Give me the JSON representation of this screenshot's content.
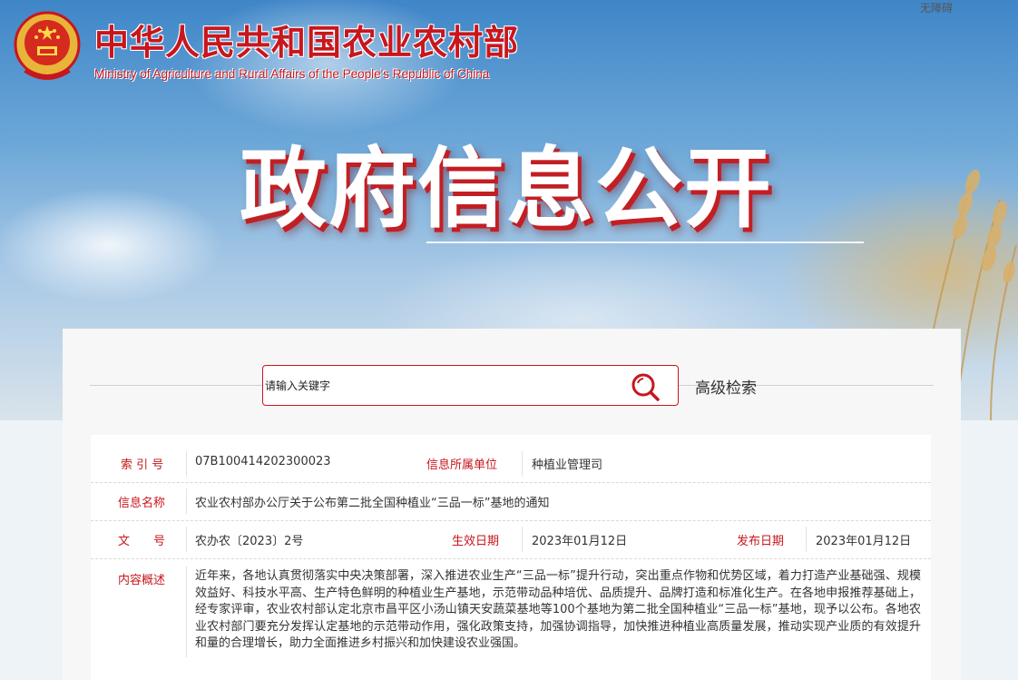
{
  "header": {
    "logo_cn": "中华人民共和国农业农村部",
    "logo_en": "Ministry of Agriculture and Rural Affairs of the People's Republic of China",
    "accessibility": "无障碍",
    "hero_title": "政府信息公开"
  },
  "search": {
    "placeholder": "请输入关键字",
    "advanced": "高级检索"
  },
  "info": {
    "index_label": "索 引 号",
    "index_value": "07B100414202300023",
    "unit_label": "信息所属单位",
    "unit_value": "种植业管理司",
    "name_label": "信息名称",
    "name_value": "农业农村部办公厅关于公布第二批全国种植业“三品一标”基地的通知",
    "doc_label": "文　　号",
    "doc_value": "农办农〔2023〕2号",
    "effective_label": "生效日期",
    "effective_value": "2023年01月12日",
    "publish_label": "发布日期",
    "publish_value": "2023年01月12日",
    "summary_label": "内容概述",
    "summary_value": "近年来，各地认真贯彻落实中央决策部署，深入推进农业生产“三品一标”提升行动，突出重点作物和优势区域，着力打造产业基础强、规模效益好、科技水平高、生产特色鲜明的种植业生产基地，示范带动品种培优、品质提升、品牌打造和标准化生产。在各地申报推荐基础上，经专家评审，农业农村部认定北京市昌平区小汤山镇天安蔬菜基地等100个基地为第二批全国种植业“三品一标”基地，现予以公布。各地农业农村部门要充分发挥认定基地的示范带动作用，强化政策支持，加强协调指导，加快推进种植业高质量发展，推动实现产业质的有效提升和量的合理增长，助力全面推进乡村振兴和加快建设农业强国。"
  },
  "colors": {
    "brand_red": "#c8161d",
    "sky_blue": "#3f86c8"
  },
  "icons": {
    "emblem": "national-emblem-icon",
    "search": "search-icon"
  }
}
